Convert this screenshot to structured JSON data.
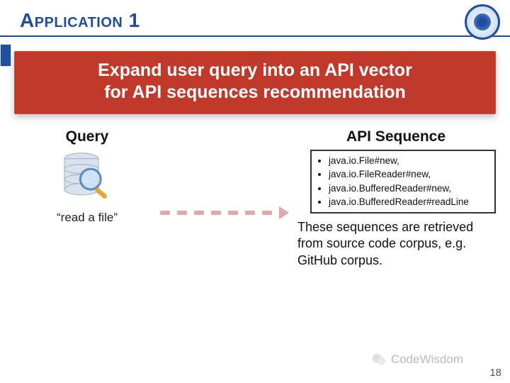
{
  "header": {
    "title": "Application 1"
  },
  "banner": {
    "line1": "Expand user query into an API vector",
    "line2": "for API sequences recommendation"
  },
  "query": {
    "label": "Query",
    "caption": "read a file"
  },
  "api_sequence": {
    "label": "API Sequence",
    "items": [
      "java.io.File#new,",
      "java.io.FileReader#new,",
      "java.io.BufferedReader#new,",
      "java.io.BufferedReader#readLine"
    ],
    "explanation": "These sequences are retrieved from source code corpus, e.g. GitHub corpus."
  },
  "watermark": "CodeWisdom",
  "page_number": "18"
}
